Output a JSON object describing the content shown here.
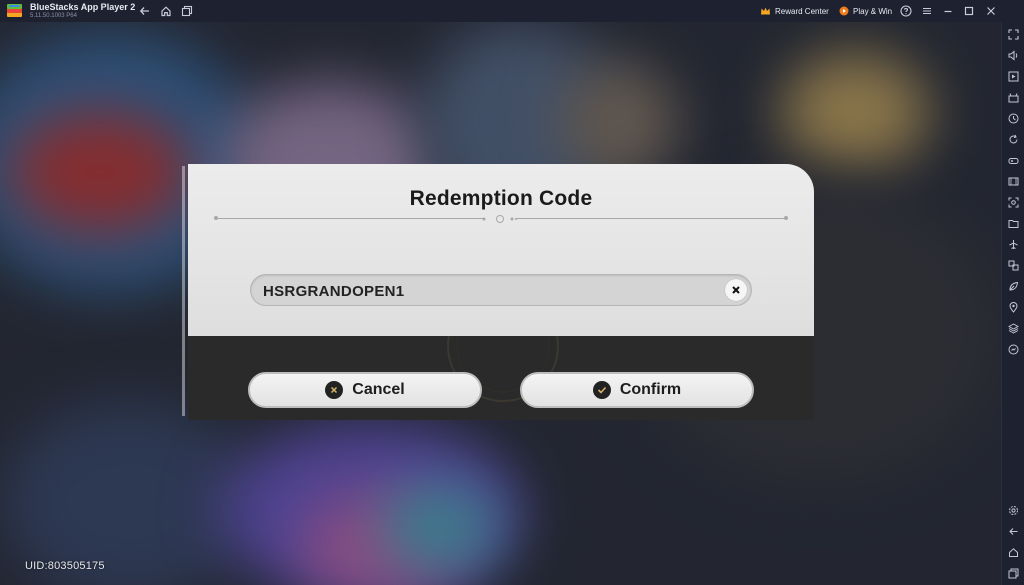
{
  "window": {
    "title": "BlueStacks App Player 2",
    "version": "5.11.50.1003  P64"
  },
  "titlebar": {
    "reward_center": "Reward Center",
    "play_win": "Play & Win"
  },
  "dialog": {
    "title": "Redemption Code",
    "code_value": "HSRGRANDOPEN1",
    "cancel_label": "Cancel",
    "confirm_label": "Confirm"
  },
  "game": {
    "uid": "UID:803505175"
  },
  "icons": {
    "back": "back-arrow-icon",
    "home": "home-icon",
    "multi_instance": "multi-instance-icon",
    "crown": "crown-icon",
    "play_win": "play-win-icon",
    "help": "help-icon",
    "menu": "menu-icon",
    "minimize": "minimize-icon",
    "maximize": "maximize-icon",
    "close": "close-icon"
  },
  "colors": {
    "titlebar": "#1e2130",
    "dialog_top": "#e6e6e6",
    "dialog_bottom": "#2a2a2a",
    "accent_orange": "#f5a623"
  }
}
